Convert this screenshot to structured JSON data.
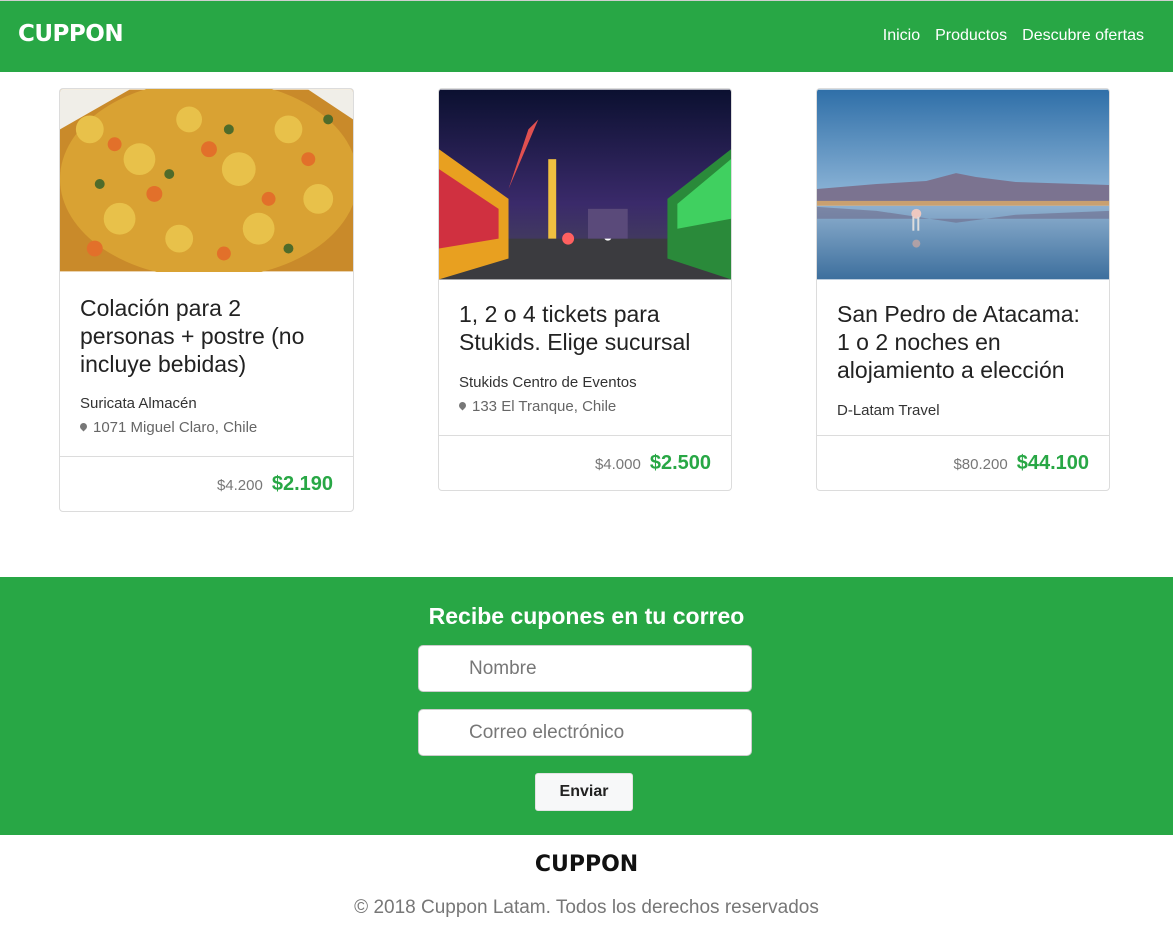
{
  "navbar": {
    "brand": "CUPPON",
    "links": [
      "Inicio",
      "Productos",
      "Descubre ofertas"
    ],
    "bg_color": "#28a745"
  },
  "deals": [
    {
      "title": "Colación para 2 personas + postre (no incluye bebidas)",
      "merchant": "Suricata Almacén",
      "location": "1071 Miguel Claro, Chile",
      "old_price": "$4.200",
      "new_price": "$2.190"
    },
    {
      "title": "1, 2 o 4 tickets para Stukids. Elige sucursal",
      "merchant": "Stukids Centro de Eventos",
      "location": "133 El Tranque, Chile",
      "old_price": "$4.000",
      "new_price": "$2.500"
    },
    {
      "title": "San Pedro de Atacama: 1 o 2 noches en alojamiento a elección",
      "merchant": "D-Latam Travel",
      "old_price": "$80.200",
      "new_price": "$44.100"
    }
  ],
  "newsletter": {
    "title": "Recibe cupones en tu correo",
    "name_placeholder": "Nombre",
    "email_placeholder": "Correo electrónico",
    "submit_label": "Enviar"
  },
  "footer": {
    "brand": "CUPPON",
    "copyright": "© 2018 Cuppon Latam. Todos los derechos reservados"
  },
  "colors": {
    "accent": "#28a745",
    "price": "#28a745"
  }
}
